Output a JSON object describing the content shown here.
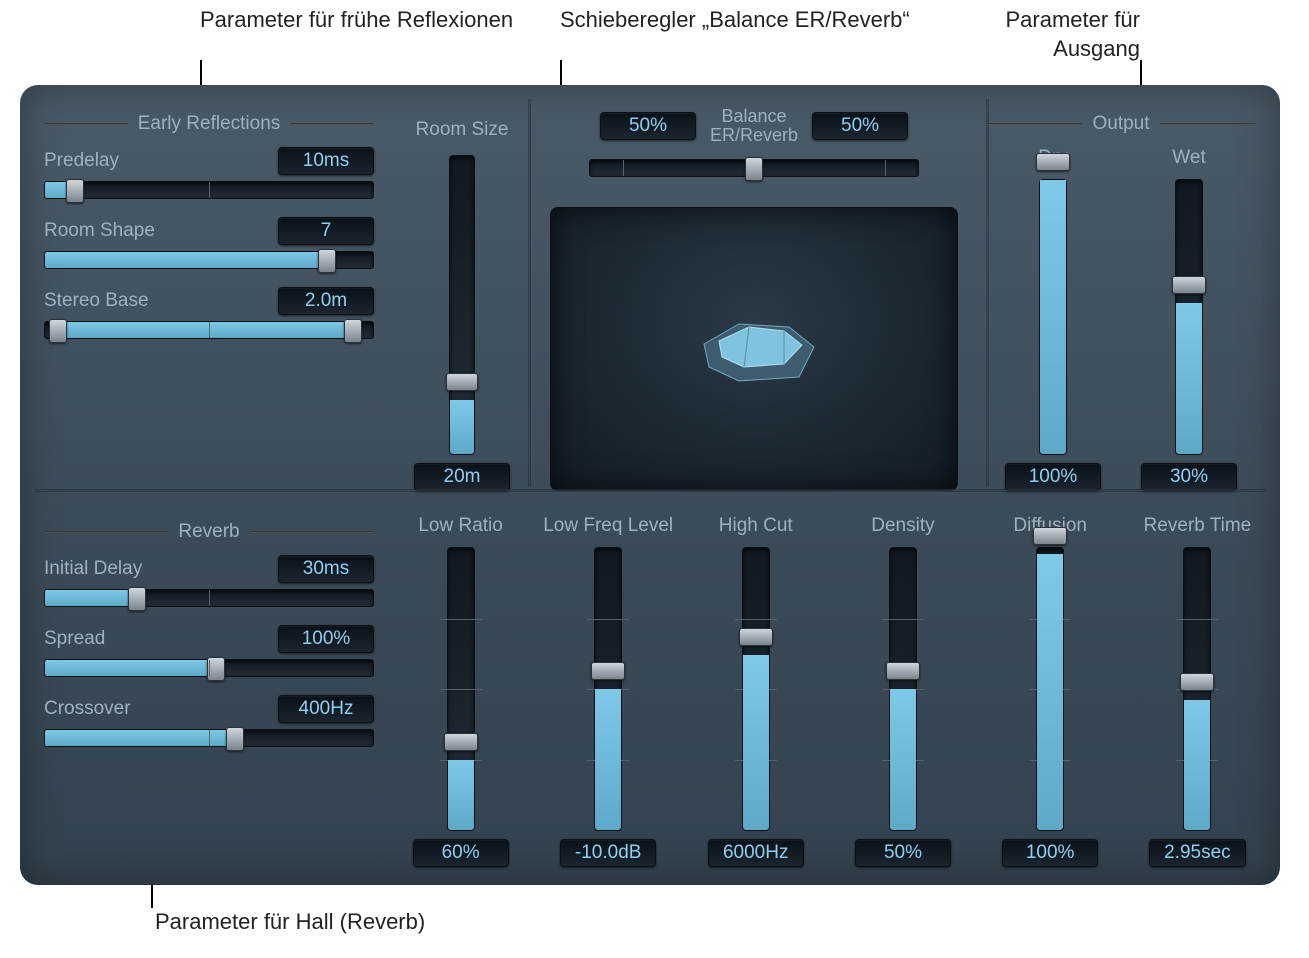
{
  "annotations": {
    "early_reflections": "Parameter für frühe Reflexionen",
    "balance": "Schieberegler „Balance ER/Reverb“",
    "output": "Parameter für Ausgang",
    "reverb": "Parameter für Hall (Reverb)"
  },
  "early_reflections": {
    "title": "Early Reflections",
    "predelay": {
      "label": "Predelay",
      "value": "10ms",
      "pct": 9
    },
    "room_shape": {
      "label": "Room Shape",
      "value": "7",
      "pct": 86
    },
    "stereo_base": {
      "label": "Stereo Base",
      "value": "2.0m",
      "left_pct": 4,
      "right_pct": 94
    }
  },
  "room_size": {
    "label": "Room Size",
    "value": "20m",
    "pct": 18
  },
  "balance": {
    "label_line1": "Balance",
    "label_line2": "ER/Reverb",
    "left": "50%",
    "right": "50%",
    "pct": 50
  },
  "output": {
    "title": "Output",
    "dry": {
      "label": "Dry",
      "value": "100%",
      "pct": 100
    },
    "wet": {
      "label": "Wet",
      "value": "30%",
      "pct": 55
    }
  },
  "reverb": {
    "title": "Reverb",
    "initial_delay": {
      "label": "Initial Delay",
      "value": "30ms",
      "pct": 28
    },
    "spread": {
      "label": "Spread",
      "value": "100%",
      "pct": 52
    },
    "crossover": {
      "label": "Crossover",
      "value": "400Hz",
      "pct": 58
    }
  },
  "reverb_sliders": {
    "low_ratio": {
      "label": "Low Ratio",
      "value": "60%",
      "pct": 25
    },
    "low_freq_level": {
      "label": "Low Freq Level",
      "value": "-10.0dB",
      "pct": 50
    },
    "high_cut": {
      "label": "High Cut",
      "value": "6000Hz",
      "pct": 62
    },
    "density": {
      "label": "Density",
      "value": "50%",
      "pct": 50
    },
    "diffusion": {
      "label": "Diffusion",
      "value": "100%",
      "pct": 98
    },
    "reverb_time": {
      "label": "Reverb Time",
      "value": "2.95sec",
      "pct": 46
    }
  }
}
